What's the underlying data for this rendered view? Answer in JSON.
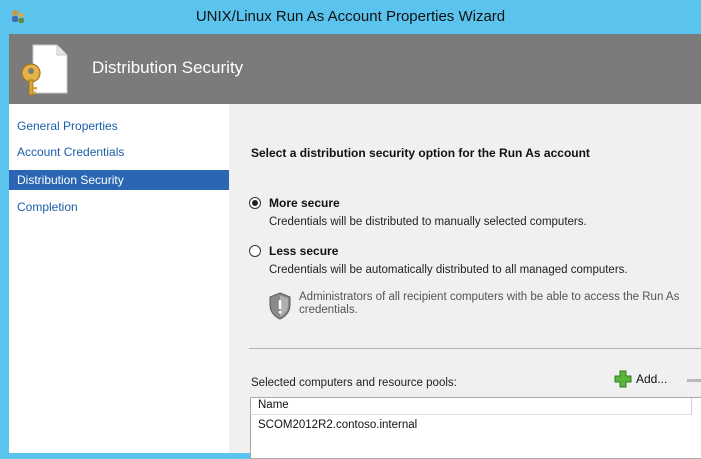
{
  "window": {
    "title": "UNIX/Linux Run As Account Properties Wizard"
  },
  "header": {
    "title": "Distribution Security",
    "icon": "document-key-icon"
  },
  "nav": {
    "items": [
      {
        "label": "General Properties",
        "selected": false
      },
      {
        "label": "Account Credentials",
        "selected": false
      },
      {
        "label": "Distribution Security",
        "selected": true
      },
      {
        "label": "Completion",
        "selected": false
      }
    ]
  },
  "content": {
    "heading": "Select a distribution security option for the Run As account",
    "options": [
      {
        "label": "More secure",
        "description": "Credentials will be distributed to manually selected computers.",
        "checked": true
      },
      {
        "label": "Less secure",
        "description": "Credentials will be automatically distributed to all managed computers.",
        "checked": false
      }
    ],
    "info": {
      "line1": "Administrators of all recipient computers with be able to access the Run As",
      "line2": "credentials."
    },
    "pools": {
      "label": "Selected computers and resource pools:",
      "add_label": "Add...",
      "column_header": "Name",
      "rows": [
        "SCOM2012R2.contoso.internal"
      ]
    }
  },
  "colors": {
    "titlebar": "#5bc4ee",
    "header": "#7b7b7b",
    "nav_selected": "#2a66b4",
    "nav_link": "#1a5fa8"
  }
}
